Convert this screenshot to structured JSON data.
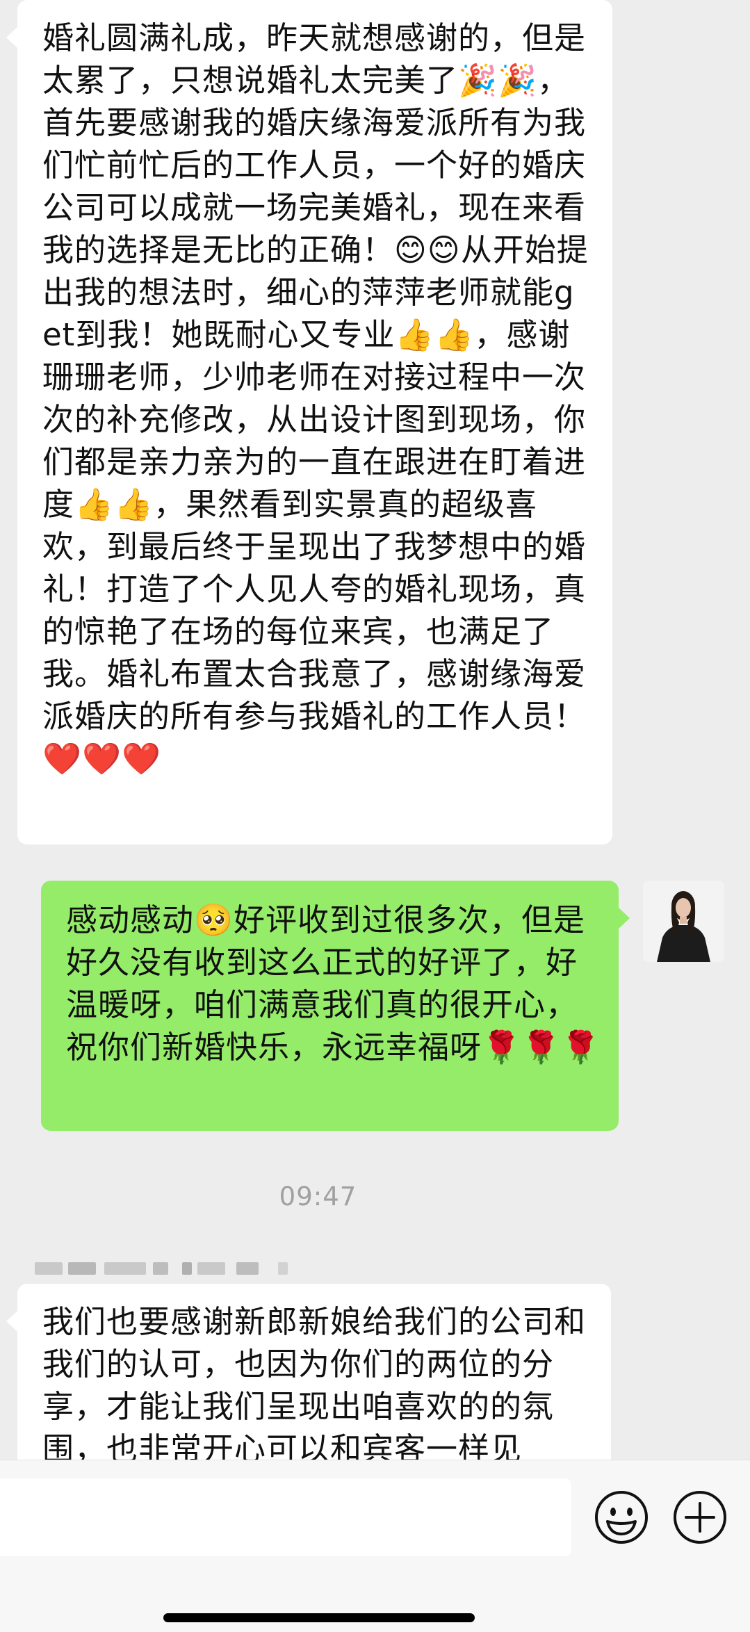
{
  "messages": [
    {
      "side": "left",
      "text": "婚礼圆满礼成，昨天就想感谢的，但是太累了，只想说婚礼太完美了🎉🎉，首先要感谢我的婚庆缘海爱派所有为我们忙前忙后的工作人员，一个好的婚庆公司可以成就一场完美婚礼，现在来看我的选择是无比的正确！😊😊从开始提出我的想法时，细心的萍萍老师就能get到我！她既耐心又专业👍👍，感谢珊珊老师，少帅老师在对接过程中一次次的补充修改，从出设计图到现场，你们都是亲力亲为的一直在跟进在盯着进度👍👍，果然看到实景真的超级喜欢，到最后终于呈现出了我梦想中的婚礼！打造了个人见人夸的婚礼现场，真的惊艳了在场的每位来宾，也满足了我。婚礼布置太合我意了，感谢缘海爱派婚庆的所有参与我婚礼的工作人员！❤️❤️❤️"
    },
    {
      "side": "right",
      "text": "感动感动🥺好评收到过很多次，但是好久没有收到这么正式的好评了，好温暖呀，咱们满意我们真的很开心，祝你们新婚快乐，永远幸福呀🌹🌹🌹"
    },
    {
      "side": "left",
      "text": "我们也要感谢新郎新娘给我们的公司和我们的认可，也因为你们的两位的分享，才能让我们呈现出咱喜欢的的氛围，也非常开心可以和宾客一样见"
    }
  ],
  "timestamp": "09:47",
  "input": {
    "value": "",
    "placeholder": ""
  },
  "icons": {
    "emoji": "smiley-face-icon",
    "plus": "plus-circle-icon"
  },
  "colors": {
    "chat_background": "#ededed",
    "received_bubble": "#ffffff",
    "sent_bubble": "#95ec69"
  }
}
